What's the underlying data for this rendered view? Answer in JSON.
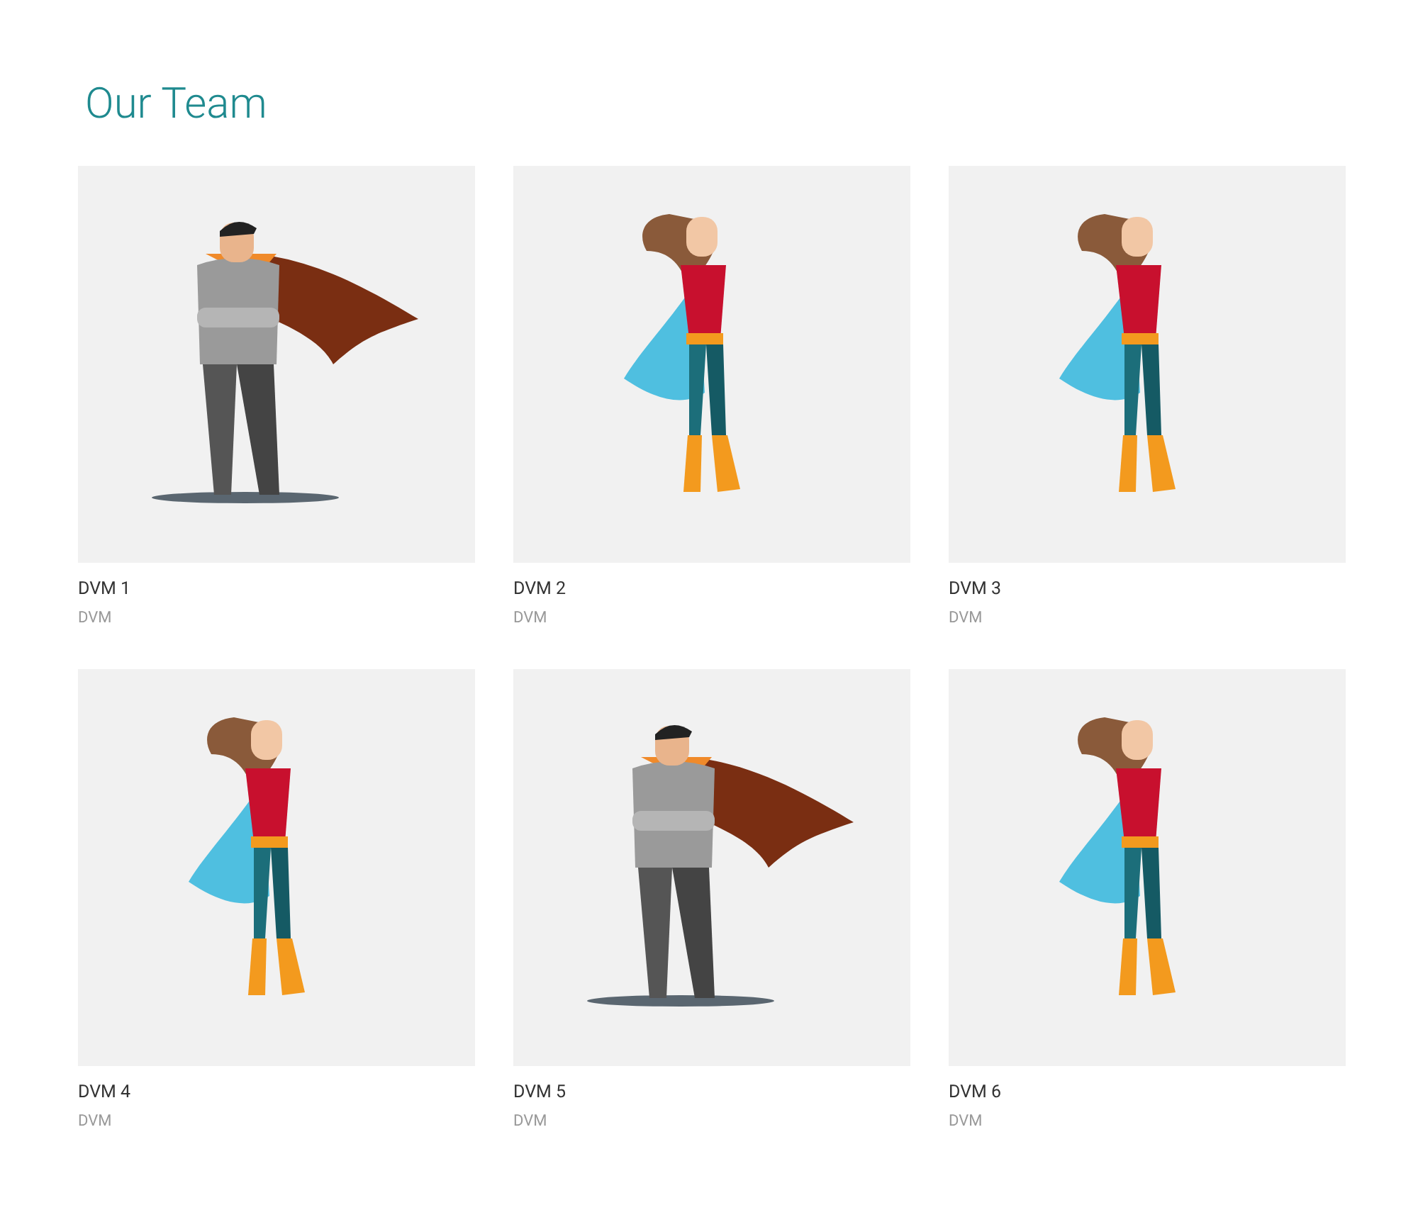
{
  "title": "Our Team",
  "members": [
    {
      "name": "DVM 1",
      "role": "DVM",
      "kind": "man"
    },
    {
      "name": "DVM 2",
      "role": "DVM",
      "kind": "woman"
    },
    {
      "name": "DVM 3",
      "role": "DVM",
      "kind": "woman"
    },
    {
      "name": "DVM 4",
      "role": "DVM",
      "kind": "woman"
    },
    {
      "name": "DVM 5",
      "role": "DVM",
      "kind": "man"
    },
    {
      "name": "DVM 6",
      "role": "DVM",
      "kind": "woman"
    }
  ]
}
